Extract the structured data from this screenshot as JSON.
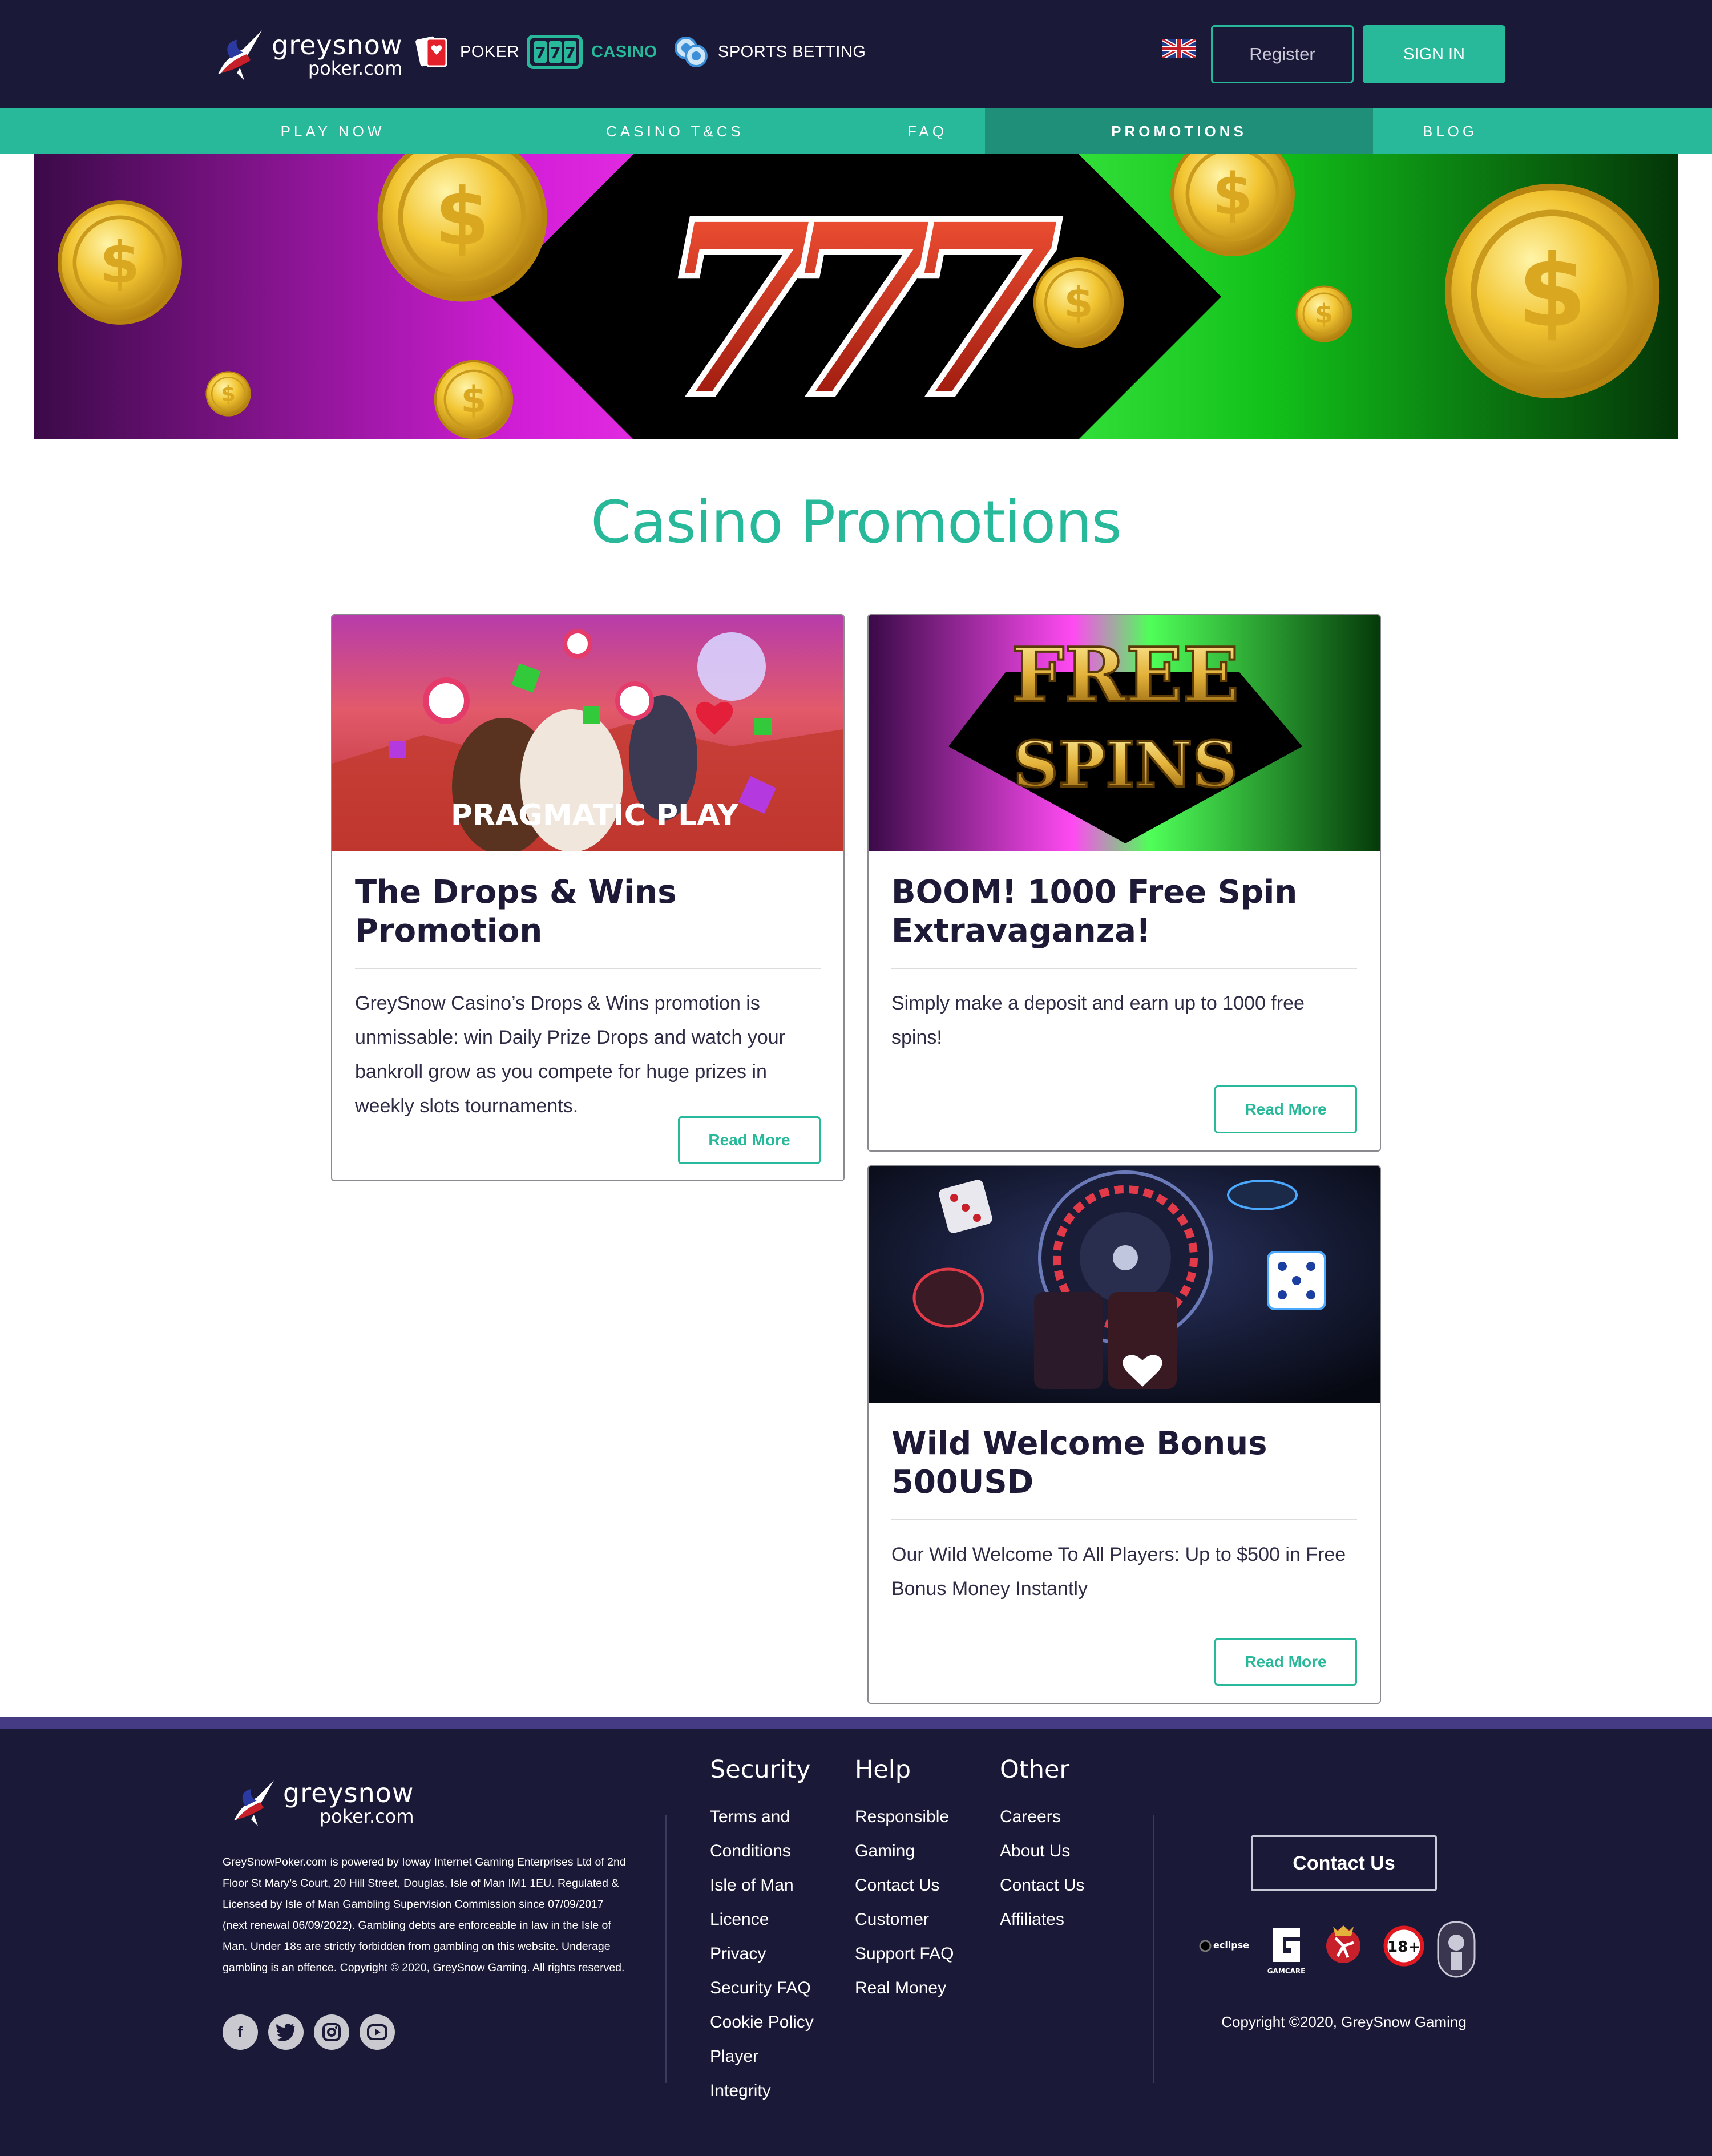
{
  "header": {
    "logo": {
      "line1": "greysnow",
      "line2": "poker.com"
    },
    "game_nav": [
      {
        "label": "POKER",
        "icon": "poker-cards-icon"
      },
      {
        "label": "CASINO",
        "icon": "slot-777-icon"
      },
      {
        "label": "SPORTS BETTING",
        "icon": "chips-icon"
      }
    ],
    "language_flag": "uk-flag-icon",
    "register_label": "Register",
    "signin_label": "SIGN IN"
  },
  "subnav": {
    "items": [
      {
        "label": "PLAY NOW"
      },
      {
        "label": "CASINO T&CS"
      },
      {
        "label": "FAQ"
      },
      {
        "label": "PROMOTIONS",
        "active": true
      },
      {
        "label": "BLOG"
      }
    ]
  },
  "main": {
    "title": "Casino Promotions",
    "promotions": [
      {
        "title": "The Drops & Wins Promotion",
        "text": "GreySnow Casino’s Drops & Wins promotion is unmissable: win Daily Prize Drops and watch your bankroll grow as you compete for huge prizes in weekly slots tournaments.",
        "button": "Read More",
        "image_text": "PRAGMATIC PLAY"
      },
      {
        "title": "BOOM! 1000 Free Spin Extravaganza!",
        "text": "Simply make a deposit and earn up to 1000 free spins!",
        "button": "Read More",
        "image_text_1": "FREE",
        "image_text_2": "SPINS"
      },
      {
        "title": "Wild Welcome Bonus 500USD",
        "text": "Our Wild Welcome To All Players: Up to $500 in Free Bonus Money Instantly",
        "button": "Read More"
      }
    ]
  },
  "footer": {
    "logo": {
      "line1": "greysnow",
      "line2": "poker.com"
    },
    "legal": "GreySnowPoker.com is powered by Ioway Internet Gaming Enterprises Ltd of 2nd Floor St Mary’s Court, 20 Hill Street, Douglas, Isle of Man IM1 1EU. Regulated & Licensed by Isle of Man Gambling Supervision Commission since 07/09/2017 (next renewal 06/09/2022). Gambling debts are enforceable in law in the Isle of Man. Under 18s are strictly forbidden from gambling on this website. Underage gambling is an offence. Copyright © 2020, GreySnow Gaming. All rights reserved.",
    "socials": [
      "facebook-icon",
      "twitter-icon",
      "instagram-icon",
      "youtube-icon"
    ],
    "columns": [
      {
        "heading": "Security",
        "links": [
          "Terms and",
          "Conditions",
          "Isle of Man",
          "Licence",
          "Privacy",
          "Security FAQ",
          "Cookie Policy",
          "Player",
          "Integrity"
        ]
      },
      {
        "heading": "Help",
        "links": [
          "Responsible",
          "Gaming",
          "Contact Us",
          "Customer",
          "Support FAQ",
          "Real Money"
        ]
      },
      {
        "heading": "Other",
        "links": [
          "Careers",
          "About Us",
          "Contact Us",
          "Affiliates"
        ]
      }
    ],
    "contact_button": "Contact Us",
    "badges": {
      "eclipse": "eclipse",
      "gamcare": "GAMCARE",
      "age": "18+"
    },
    "copyright": "Copyright ©2020, GreySnow Gaming"
  }
}
